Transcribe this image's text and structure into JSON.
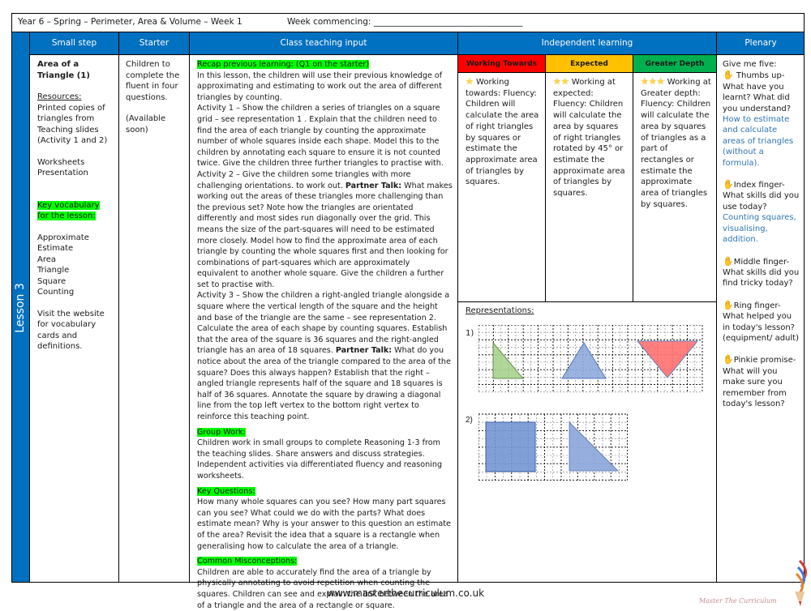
{
  "header": {
    "title": "Year 6 – Spring – Perimeter, Area & Volume – Week 1",
    "week_commencing": "Week commencing: ___________________________________"
  },
  "columns": {
    "small_step": "Small step",
    "starter": "Starter",
    "class_teaching": "Class teaching input",
    "independent": "Independent learning",
    "plenary": "Plenary"
  },
  "lesson_label": "Lesson 3",
  "small_step": {
    "title": "Area of a Triangle (1)",
    "resources_label": "Resources:",
    "resources": "Printed copies of triangles from Teaching slides (Activity 1 and 2)",
    "worksheets": "Worksheets",
    "presentation": "Presentation",
    "vocab_label": "Key vocabulary for the lesson:",
    "vocab": [
      "Approximate",
      "Estimate",
      "Area",
      "Triangle",
      "Square",
      "Counting"
    ],
    "visit": "Visit the website for vocabulary cards and definitions."
  },
  "starter": {
    "text": "Children to complete the fluent in four questions.",
    "availability": "(Available soon)"
  },
  "teaching": {
    "recap_label": "Recap previous learning: (Q1 on the starter)",
    "intro": "In this lesson, the children will use their previous knowledge of approximating and estimating to work out the area of different triangles by counting.",
    "activity1": "Activity 1 – Show the children a series of triangles on a square grid – see representation 1 . Explain that the children need to find the area of each triangle by counting the approximate number of whole squares inside each shape. Model this to the children by annotating each square to ensure it is not counted twice.  Give the children three further triangles to practise with.",
    "activity2_a": "Activity 2 – Give the children some triangles with more challenging orientations. to work out. ",
    "partner_talk": "Partner Talk:",
    "activity2_b": " What makes working out the areas of these triangles more challenging than the previous set? Note how the triangles are orientated  differently and most sides run diagonally over the grid. This means the size of the part-squares will need to be estimated more closely. Model how to find the approximate area of each triangle by counting the whole squares first and then looking for combinations of part-squares which are approximately equivalent to another whole square. Give the children a further set to practise with.",
    "activity3_a": "Activity 3 – Show the children a right-angled triangle alongside a square where the vertical length of the square and the height and base of the triangle are the same – see representation 2. Calculate the area of each shape by counting squares. Establish that the area of the square is 36 squares and the right-angled triangle has an area of 18 squares. ",
    "activity3_b": " What do you notice about the area of the triangle compared to the area of the square? Does this always happen? Establish that the right –angled triangle represents half of the square and 18 squares is half of 36 squares. Annotate the square by drawing a diagonal line from the top left vertex to the bottom right vertex to reinforce this teaching point.",
    "group_label": "Group Work:",
    "group": "Children work in small groups to complete Reasoning 1-3 from the teaching slides. Share answers and discuss strategies. Independent activities via differentiated fluency and reasoning worksheets.",
    "questions_label": "Key Questions:",
    "questions": "How many whole squares can you see? How many part squares can you see? What could we do with the parts? What does estimate mean? Why is your answer to this question an estimate of the area? Revisit the idea that a square is a rectangle when generalising how to calculate the area of a triangle.",
    "misconceptions_label": "Common Misconceptions:",
    "misconceptions": "Children are able to accurately find the area of a triangle by physically annotating to avoid repetition when counting the squares. Children can see and explain the link between the area of a triangle and the area of a rectangle or square."
  },
  "independent": {
    "levels": [
      {
        "label": "Working Towards",
        "color": "#FF0000",
        "stars": "★",
        "text": " Working towards: Fluency: Children will calculate the area of right triangles by squares or estimate the approximate area of triangles by squares."
      },
      {
        "label": "Expected",
        "color": "#FFC000",
        "stars": "★★",
        "text": " Working at expected: Fluency: Children will calculate the area by squares of right triangles rotated by 45° or estimate the approximate area of triangles by squares."
      },
      {
        "label": "Greater Depth",
        "color": "#00B050",
        "stars": "★★★",
        "text": " Working at Greater depth: Fluency: Children will calculate the area by squares of triangles as a part of rectangles or estimate the approximate area of triangles by squares."
      }
    ],
    "representations_label": "Representations:",
    "rep1_label": "1)",
    "rep2_label": "2)",
    "shape_colors": {
      "green": "#A9D18E",
      "blue": "#8FAADC",
      "red": "#FF7070",
      "dark_blue": "#7496D4"
    }
  },
  "plenary": {
    "intro": "Give me five:",
    "items": [
      {
        "prompt": " Thumbs up- What have you learnt? What did you understand?",
        "answer": "How to estimate and calculate areas of triangles (without a formula)."
      },
      {
        "prompt": "Index finger- What skills did you use today?",
        "answer": "Counting squares, visualising, addition."
      },
      {
        "prompt": "Middle finger- What skills did you find tricky today?",
        "answer": ""
      },
      {
        "prompt": "Ring finger- What helped you in today's lesson? (equipment/ adult)",
        "answer": ""
      },
      {
        "prompt": "Pinkie promise- What will you make sure you remember from today's lesson?",
        "answer": ""
      }
    ]
  },
  "footer": {
    "url": "www.masterthecurriculum.co.uk",
    "logo_text": "Master The Curriculum"
  }
}
